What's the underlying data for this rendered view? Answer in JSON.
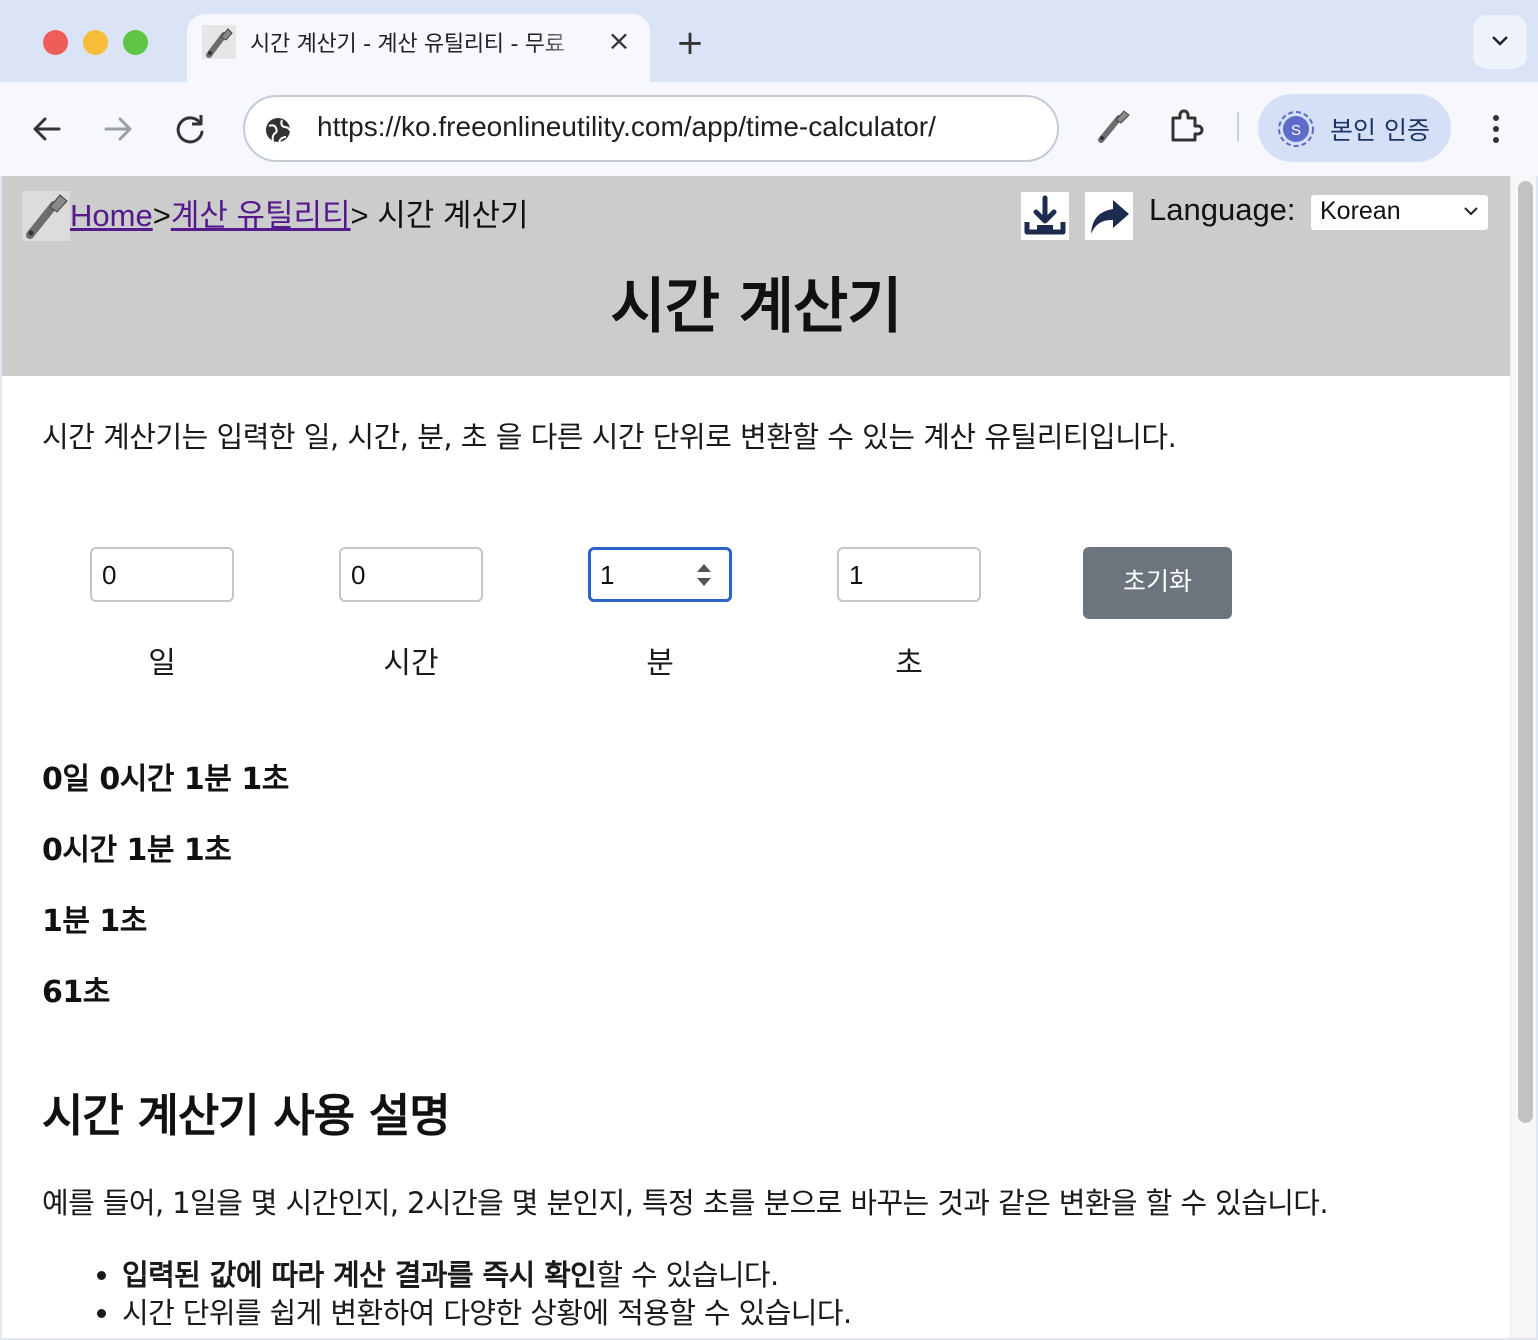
{
  "browser": {
    "tab_title": "시간 계산기 - 계산 유틸리티 - 무료",
    "url": "https://ko.freeonlineutility.com/app/time-calculator/",
    "profile_label": "본인 인증",
    "profile_initial": "S",
    "accent_color": "#d5e0f7"
  },
  "header": {
    "breadcrumb": {
      "home": "Home",
      "separator_1": ">",
      "category": "계산 유틸리티",
      "separator_2": ">",
      "current": " 시간 계산기"
    },
    "language_label": "Language:",
    "language_value": "Korean",
    "title": "시간 계산기",
    "background_color": "#cccccc"
  },
  "intro_text": "시간 계산기는 입력한 일, 시간, 분, 초 을 다른 시간 단위로 변환할 수 있는 계산 유틸리티입니다.",
  "inputs": [
    {
      "value": "0",
      "label": "일"
    },
    {
      "value": "0",
      "label": "시간"
    },
    {
      "value": "1",
      "label": "분"
    },
    {
      "value": "1",
      "label": "초"
    }
  ],
  "reset_label": "초기화",
  "reset_color": "#6c757d",
  "results": [
    "0일 0시간 1분 1초",
    "0시간 1분 1초",
    "1분 1초",
    "61초"
  ],
  "usage": {
    "title": "시간 계산기 사용 설명",
    "body": "예를 들어, 1일을 몇 시간인지, 2시간을 몇 분인지, 특정 초를 분으로 바꾸는 것과 같은 변환을 할 수 있습니다.",
    "bullet_1_bold": "입력된 값에 따라 계산 결과를 즉시 확인",
    "bullet_1_rest": "할 수 있습니다.",
    "bullet_2": "시간 단위를 쉽게 변환하여 다양한 상황에 적용할 수 있습니다."
  }
}
